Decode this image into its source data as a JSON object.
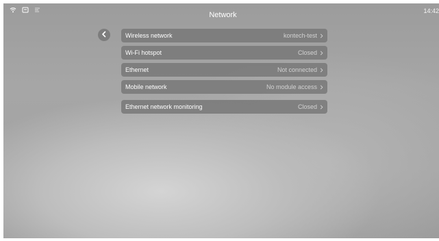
{
  "header": {
    "title": "Network",
    "time": "14:42"
  },
  "status_icons": [
    "wifi-icon",
    "screen-icon",
    "notification-list-icon"
  ],
  "back_icon": "chevron-left-icon",
  "menu": {
    "items": [
      {
        "label": "Wireless network",
        "value": "kontech-test"
      },
      {
        "label": "Wi-Fi hotspot",
        "value": "Closed"
      },
      {
        "label": "Ethernet",
        "value": "Not connected"
      },
      {
        "label": "Mobile network",
        "value": "No module access"
      },
      {
        "label": "Ethernet network monitoring",
        "value": "Closed"
      }
    ]
  },
  "colors": {
    "background": "#a3a3a3",
    "row_background": "#7a7a7a",
    "text": "#ffffff",
    "value_text": "#d2d2d2"
  }
}
